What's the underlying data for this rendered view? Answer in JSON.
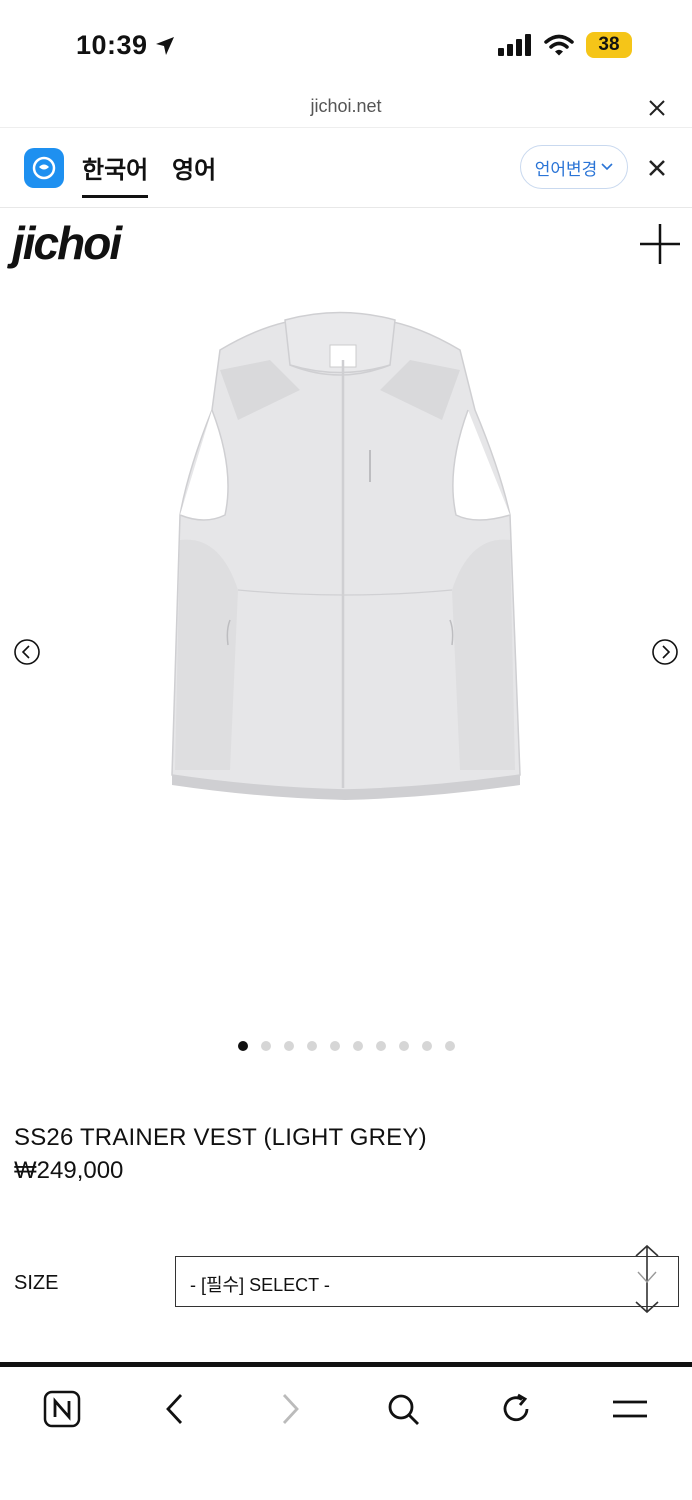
{
  "status_bar": {
    "time": "10:39",
    "battery": "38"
  },
  "browser": {
    "url": "jichoi.net"
  },
  "translate_bar": {
    "tab_korean": "한국어",
    "tab_english": "영어",
    "change_language": "언어변경"
  },
  "site": {
    "logo": "jichoi"
  },
  "carousel": {
    "slide_count": 10,
    "active_index": 0
  },
  "product": {
    "title": "SS26 TRAINER VEST (LIGHT GREY)",
    "price": "₩249,000",
    "size_label": "SIZE",
    "size_placeholder": "- [필수] SELECT -"
  },
  "colors": {
    "accent_blue": "#2a74d6",
    "battery_yellow": "#f5c518",
    "translate_logo": "#1e90f0"
  }
}
